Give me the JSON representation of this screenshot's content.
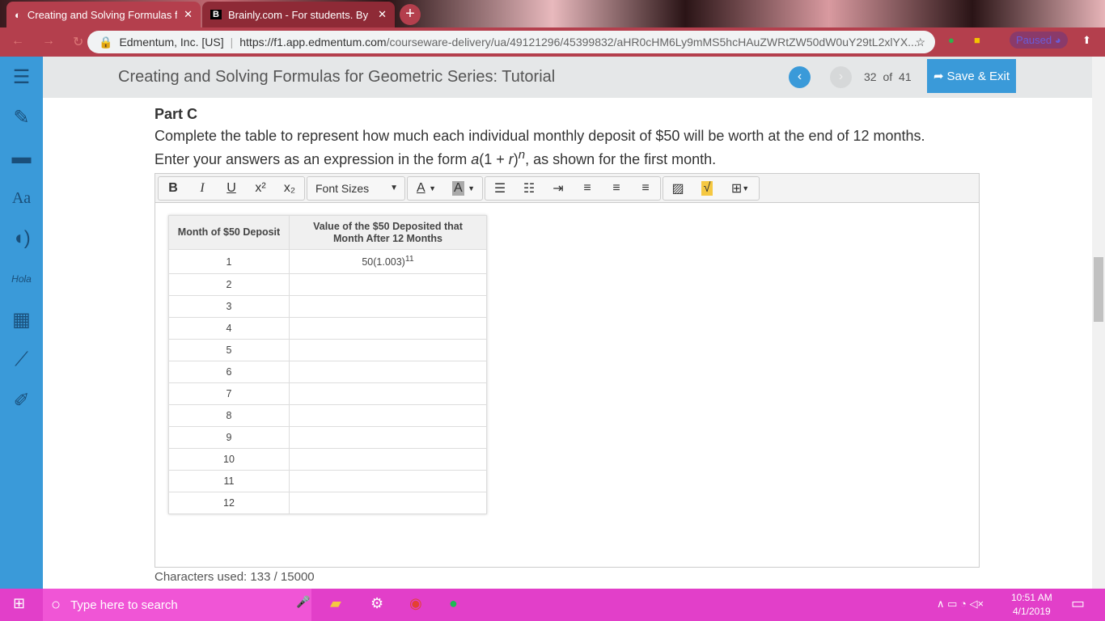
{
  "browser": {
    "tabs": [
      {
        "title": "Creating and Solving Formulas for Geometric Series: Tutorial",
        "display": "Creating and Solving Formulas fo"
      },
      {
        "title": "Brainly.com - For students. By stu",
        "display": "Brainly.com - For students. By stu"
      }
    ],
    "site_identity": "Edmentum, Inc. [US]",
    "url_host": "https://f1.app.edmentum.com",
    "url_path": "/courseware-delivery/ua/49121296/45399832/aHR0cHM6Ly9mMS5hcHAuZWRtZW50dW0uY29tL2xlYX...",
    "profile_status": "Paused"
  },
  "header": {
    "title": "Creating and Solving Formulas for Geometric Series: Tutorial",
    "page_current": "32",
    "page_of": "of",
    "page_total": "41",
    "save_exit": "Save & Exit"
  },
  "content": {
    "part": "Part C",
    "instruction_line1": "Complete the table to represent how much each individual monthly deposit of $50 will be worth at the end of 12 months.",
    "instruction_line2_pre": "Enter your answers as an expression in the form ",
    "form_a": "a",
    "form_mid": "(1 + ",
    "form_r": "r",
    "form_close": ")",
    "form_n": "n",
    "instruction_line2_post": ", as shown for the first month.",
    "toolbar": {
      "font_sizes": "Font Sizes"
    },
    "table": {
      "headers": [
        "Month of $50 Deposit",
        "Value of the $50 Deposited that Month After 12 Months"
      ],
      "rows": [
        {
          "month": "1",
          "value_base": "50(1.003)",
          "value_exp": "11"
        },
        {
          "month": "2"
        },
        {
          "month": "3"
        },
        {
          "month": "4"
        },
        {
          "month": "5"
        },
        {
          "month": "6"
        },
        {
          "month": "7"
        },
        {
          "month": "8"
        },
        {
          "month": "9"
        },
        {
          "month": "10"
        },
        {
          "month": "11"
        },
        {
          "month": "12"
        }
      ]
    },
    "chars_used": "Characters used: 133 / 15000"
  },
  "taskbar": {
    "search_placeholder": "Type here to search",
    "time": "10:51 AM",
    "date": "4/1/2019"
  },
  "colors": {
    "accent": "#3a9ad9",
    "browser": "#b43f4d",
    "taskbar": "#e23fc9"
  }
}
